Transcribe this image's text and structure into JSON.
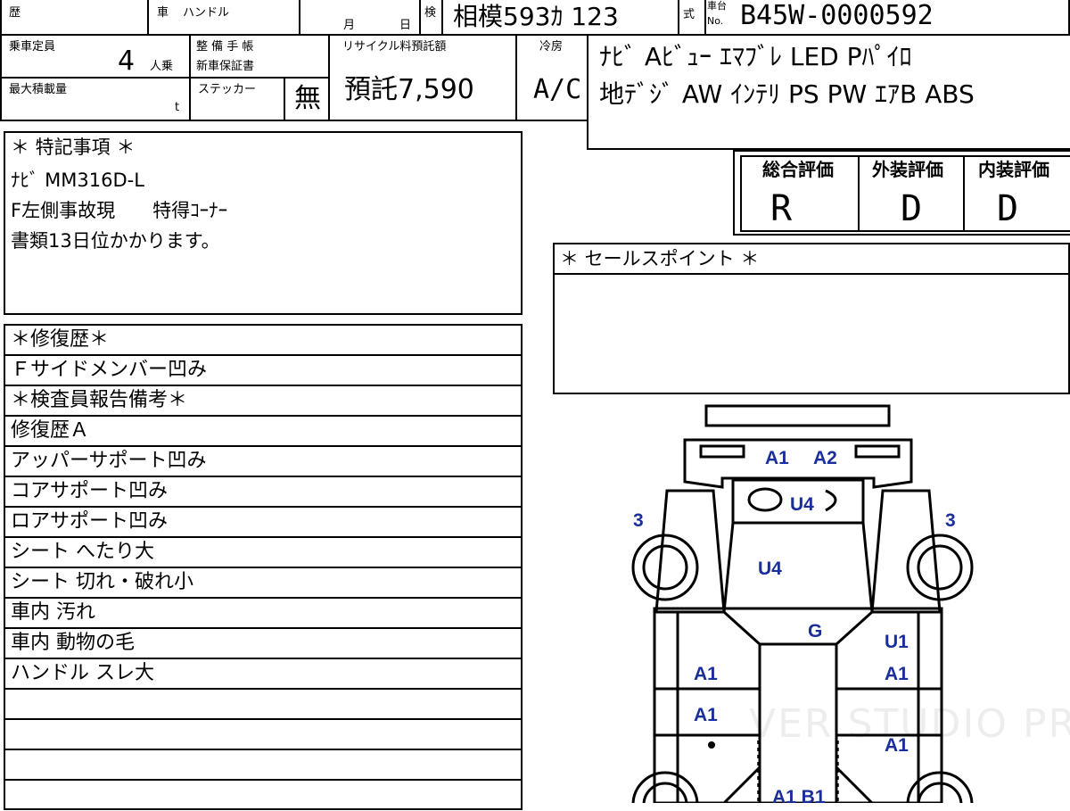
{
  "header": {
    "history_label": "歴",
    "car_label": "車",
    "handle_label": "ハンドル",
    "month_label": "月",
    "day_label": "日",
    "inspection_label": "検",
    "plate": "相模593ｶ 123",
    "model_label": "式",
    "chassis_no_label_top": "車台",
    "chassis_no_label_bottom": "No.",
    "chassis_no": "B45W-0000592"
  },
  "specs": {
    "capacity_label": "乗車定員",
    "capacity_value": "4",
    "capacity_unit": "人乗",
    "maintenance_label": "整 備 手 帳",
    "warranty_label": "新車保証書",
    "recycle_label": "リサイクル料預託額",
    "recycle_value": "預託7,590",
    "cooler_label": "冷房",
    "cooler_value": "A/C",
    "load_label": "最大積載量",
    "load_unit": "t",
    "sticker_label": "ステッカー",
    "sticker_value": "無"
  },
  "equipment": {
    "line1": "ﾅﾋﾞ Aﾋﾞｭｰ ｴﾏﾌﾞﾚ LED Pﾊﾟｲﾛ",
    "line2": "地ﾃﾞｼﾞ AW ｲﾝﾃﾘ PS PW ｴｱB ABS"
  },
  "special_notes": {
    "title": "＊ 特記事項 ＊",
    "lines": [
      "ﾅﾋﾞ MM316D-L",
      "F左側事故現　　特得ｺｰﾅｰ",
      "書類13日位かかります。"
    ]
  },
  "ratings": {
    "overall_label": "総合評価",
    "exterior_label": "外装評価",
    "interior_label": "内装評価",
    "overall": "R",
    "exterior": "D",
    "interior": "D"
  },
  "sales_points": {
    "title": "＊ セールスポイント ＊"
  },
  "repair": {
    "rows": [
      "＊修復歴＊",
      "Ｆサイドメンバー凹み",
      "＊検査員報告備考＊",
      "修復歴Ａ",
      "アッパーサポート凹み",
      "コアサポート凹み",
      "ロアサポート凹み",
      "シート へたり大",
      "シート 切れ・破れ小",
      "車内 汚れ",
      "車内 動物の毛",
      "ハンドル スレ大",
      "",
      "",
      "",
      ""
    ]
  },
  "diagram": {
    "labels": {
      "a1_top": "A1",
      "a2_top": "A2",
      "u4_hood": "U4",
      "u4_front": "U4",
      "three_left": "3",
      "three_right": "3",
      "g": "G",
      "u1": "U1",
      "a1_left_1": "A1",
      "a1_left_2": "A1",
      "a1_right_1": "A1",
      "a1_right_2": "A1",
      "a1b1_bottom": "A1 B1"
    }
  },
  "watermark": "VER STUDIO PRO"
}
